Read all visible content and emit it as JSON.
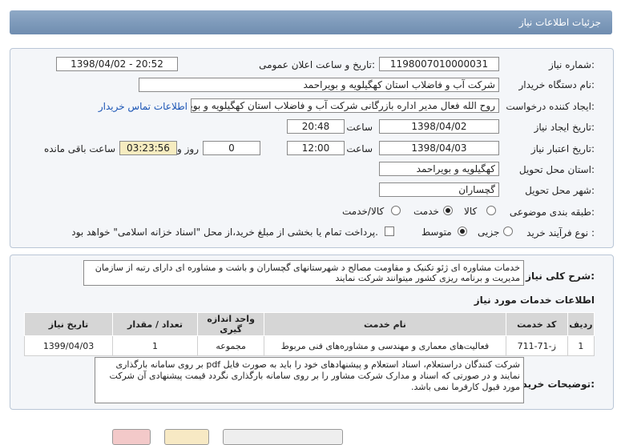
{
  "header": {
    "title": "جزئیات اطلاعات نیاز"
  },
  "form": {
    "need_no_label": "شماره نیاز:",
    "need_no": "1198007010000031",
    "announce_label": "تاریخ و ساعت اعلان عمومی:",
    "announce_value": "1398/04/02 - 20:52",
    "buyer_label": "نام دستگاه خریدار:",
    "buyer_value": "شرکت آب و فاضلاب استان کهگیلویه و بویراحمد",
    "creator_label": "ایجاد کننده درخواست:",
    "creator_value": "روح الله فعال مدیر اداره بازرگانی شرکت آب و فاضلاب استان کهگیلویه و بویراحمد",
    "contact_link": "اطلاعات تماس خریدار",
    "created_label": "تاریخ ایجاد نیاز:",
    "created_date": "1398/04/02",
    "time_label": "ساعت",
    "created_time": "20:48",
    "valid_label": "تاریخ اعتبار نیاز:",
    "valid_date": "1398/04/03",
    "valid_time": "12:00",
    "days_value": "0",
    "days_label": "روز و",
    "remaining_time": "03:23:56",
    "remaining_label": "ساعت باقی مانده",
    "province_label": "استان محل تحویل:",
    "province_value": "کهگیلویه و بویراحمد",
    "city_label": "شهر محل تحویل:",
    "city_value": "گچساران",
    "category_label": "طبقه بندی موضوعی:",
    "cat_goods": "کالا",
    "cat_service": "خدمت",
    "cat_goods_service": "کالا/خدمت",
    "process_label": "نوع فرآیند خرید :",
    "proc_partial": "جزیی",
    "proc_medium": "متوسط",
    "payment_note": "پرداخت تمام یا بخشی از مبلغ خرید،از محل \"اسناد خزانه اسلامی\" خواهد بود."
  },
  "description": {
    "label": "شرح کلی نیاز:",
    "text": "خدمات مشاوره ای ژئو تکنیک و مقاومت مصالح د شهرستانهای گچساران و باشت و مشاوره ای دارای رتبه از سازمان مدیریت و برنامه ریزی کشور میتوانند شرکت نمایند"
  },
  "services": {
    "title": "اطلاعات خدمات مورد نیاز",
    "columns": [
      "ردیف",
      "کد خدمت",
      "نام خدمت",
      "واحد اندازه گیری",
      "تعداد / مقدار",
      "تاریخ نیاز"
    ],
    "rows": [
      [
        "1",
        "ز-71-711",
        "فعالیت‌های معماری و مهندسی و مشاوره‌های فنی مربوط",
        "مجموعه",
        "1",
        "1399/04/03"
      ]
    ]
  },
  "buyer_notes": {
    "label": "توضیحات خریدار:",
    "text": "شرکت کنندگان دراستعلام، اسناد استعلام و پیشنهادهای خود را باید به صورت فایل pdf بر روی سامانه بارگذاری نمایند و در صورتی که اسناد  و مدارک شرکت مشاور را بر روی سامانه بارگذاری نگردد قیمت پیشنهادی آن شرکت مورد قبول کارفرما نمی باشد."
  }
}
